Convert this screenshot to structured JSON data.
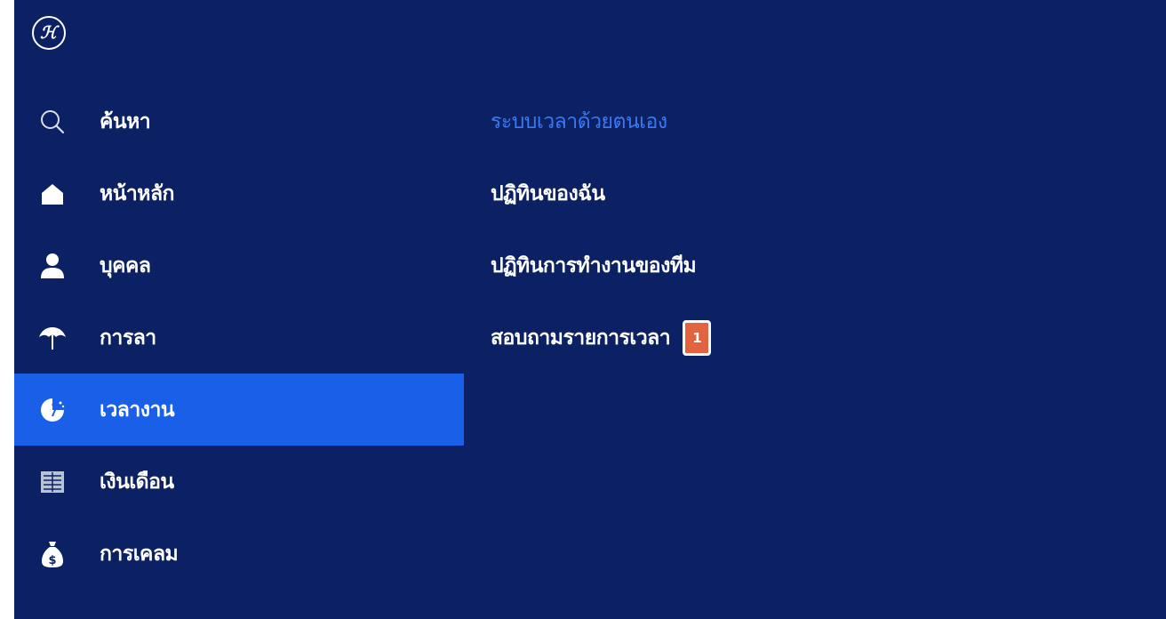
{
  "logo": {
    "icon": "h-logo-icon",
    "text": "ℋ"
  },
  "sidebar": {
    "items": [
      {
        "label": "ค้นหา",
        "icon": "search-icon",
        "active": false
      },
      {
        "label": "หน้าหลัก",
        "icon": "home-icon",
        "active": false
      },
      {
        "label": "บุคคล",
        "icon": "person-icon",
        "active": false
      },
      {
        "label": "การลา",
        "icon": "umbrella-icon",
        "active": false
      },
      {
        "label": "เวลางาน",
        "icon": "clock-icon",
        "active": true
      },
      {
        "label": "เงินเดือน",
        "icon": "payroll-icon",
        "active": false
      },
      {
        "label": "การเคลม",
        "icon": "money-bag-icon",
        "active": false
      }
    ]
  },
  "submenu": {
    "heading": "ระบบเวลาด้วยตนเอง",
    "items": [
      {
        "label": "ปฏิทินของฉัน"
      },
      {
        "label": "ปฏิทินการทำงานของทีม"
      },
      {
        "label": "สอบถามรายการเวลา",
        "badge": "1"
      }
    ]
  },
  "colors": {
    "background": "#0b2163",
    "active_item": "#1a5fe8",
    "heading": "#3e78f2",
    "badge": "#e2633f",
    "text": "#ffffff"
  }
}
